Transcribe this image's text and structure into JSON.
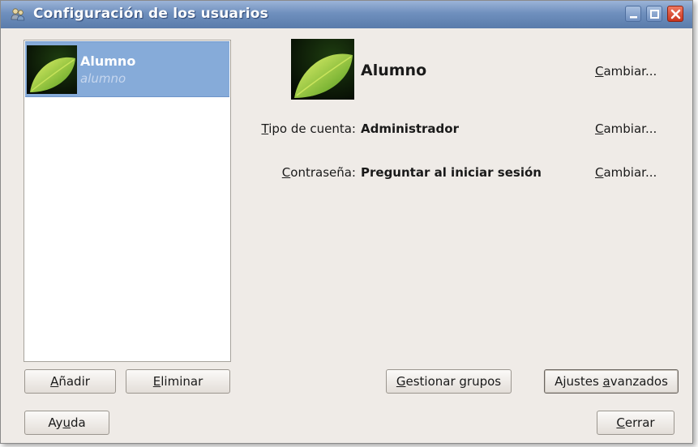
{
  "window": {
    "title": "Configuración de los usuarios"
  },
  "user_list": {
    "items": [
      {
        "name": "Alumno",
        "login": "alumno",
        "selected": true
      }
    ]
  },
  "details": {
    "full_name": "Alumno",
    "change_name_label": "Cambiar...",
    "account_type_label": "Tipo de cuenta:",
    "account_type_value": "Administrador",
    "change_account_type_label": "Cambiar...",
    "password_label": "Contraseña:",
    "password_value": "Preguntar al iniciar sesión",
    "change_password_label": "Cambiar..."
  },
  "buttons": {
    "add": "Añadir",
    "delete": "Eliminar",
    "manage_groups": "Gestionar grupos",
    "advanced": "Ajustes avanzados",
    "help": "Ayuda",
    "close": "Cerrar"
  },
  "colors": {
    "selection": "#86abd9",
    "titlebar": "#6f8fbd",
    "window_bg": "#efebe7"
  }
}
